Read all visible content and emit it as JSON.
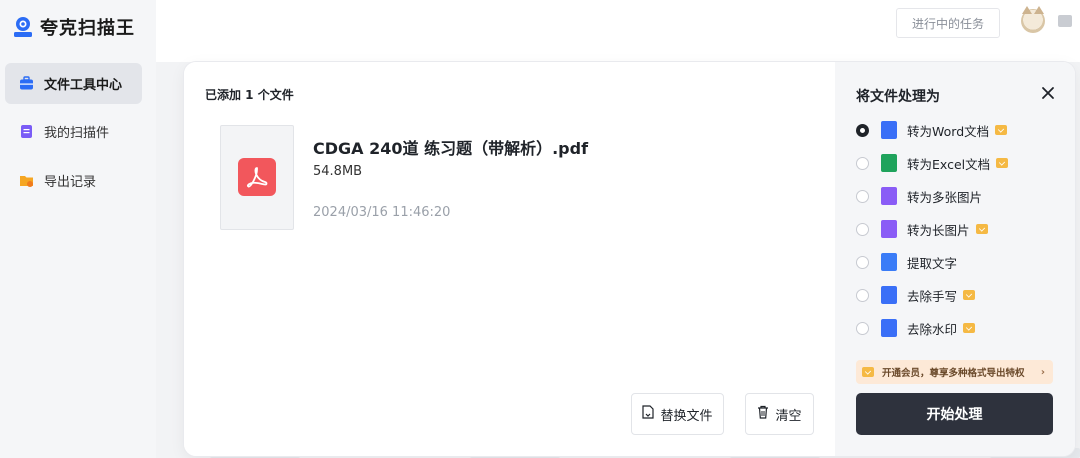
{
  "app": {
    "name": "夸克扫描王"
  },
  "sidebar": {
    "items": [
      {
        "label": "文件工具中心",
        "icon": "toolbox-icon",
        "active": true
      },
      {
        "label": "我的扫描件",
        "icon": "scan-doc-icon",
        "active": false
      },
      {
        "label": "导出记录",
        "icon": "export-folder-icon",
        "active": false
      }
    ]
  },
  "header": {
    "tasks_label": "进行中的任务"
  },
  "dialog": {
    "added_label": "已添加 1 个文件",
    "file": {
      "name": "CDGA 240道 练习题（带解析）.pdf",
      "size": "54.8MB",
      "date": "2024/03/16 11:46:20"
    },
    "replace_label": "替换文件",
    "clear_label": "清空",
    "process_title": "将文件处理为",
    "options": [
      {
        "label": "转为Word文档",
        "checked": true,
        "vip": true,
        "icon": "word-doc-icon",
        "color": "#3a6ff7"
      },
      {
        "label": "转为Excel文档",
        "checked": false,
        "vip": true,
        "icon": "excel-doc-icon",
        "color": "#1fa35c"
      },
      {
        "label": "转为多张图片",
        "checked": false,
        "vip": false,
        "icon": "images-icon",
        "color": "#8a5cf6"
      },
      {
        "label": "转为长图片",
        "checked": false,
        "vip": true,
        "icon": "long-image-icon",
        "color": "#8a5cf6"
      },
      {
        "label": "提取文字",
        "checked": false,
        "vip": false,
        "icon": "text-extract-icon",
        "color": "#3a7cf7"
      },
      {
        "label": "去除手写",
        "checked": false,
        "vip": true,
        "icon": "eraser-icon",
        "color": "#3a6ff7"
      },
      {
        "label": "去除水印",
        "checked": false,
        "vip": true,
        "icon": "watermark-drop-icon",
        "color": "#3a6ff7"
      }
    ],
    "promo_text": "开通会员，尊享多种格式导出特权",
    "start_label": "开始处理"
  }
}
